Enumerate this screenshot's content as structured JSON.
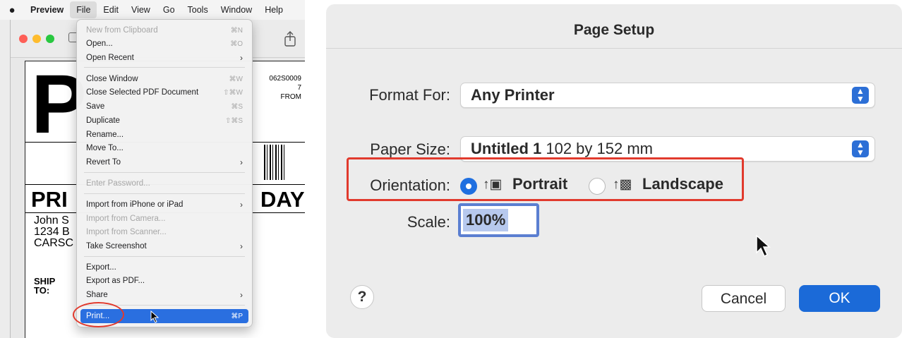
{
  "preview": {
    "menubar": {
      "app_name": "Preview",
      "items": [
        "File",
        "Edit",
        "View",
        "Go",
        "Tools",
        "Window",
        "Help"
      ],
      "active_item": "File"
    },
    "document": {
      "big_letter": "P",
      "tracking_top": "062S0009",
      "tracking_line2": "7",
      "from_label": "FROM",
      "service_left": "PRI",
      "service_right": "DAY",
      "address_lines": [
        "John S",
        "1234 B",
        "CARSC"
      ],
      "ship_to": [
        "SHIP",
        "TO:"
      ]
    },
    "file_menu": [
      {
        "label": "New from Clipboard",
        "shortcut": "⌘N",
        "disabled": true
      },
      {
        "label": "Open...",
        "shortcut": "⌘O"
      },
      {
        "label": "Open Recent",
        "submenu": true
      },
      {
        "label": "Close Window",
        "shortcut": "⌘W"
      },
      {
        "label": "Close Selected PDF Document",
        "shortcut": "⇧⌘W"
      },
      {
        "label": "Save",
        "shortcut": "⌘S"
      },
      {
        "label": "Duplicate",
        "shortcut": "⇧⌘S"
      },
      {
        "label": "Rename..."
      },
      {
        "label": "Move To..."
      },
      {
        "label": "Revert To",
        "submenu": true
      },
      {
        "label": "Enter Password...",
        "disabled": true
      },
      {
        "label": "Import from iPhone or iPad",
        "submenu": true
      },
      {
        "label": "Import from Camera...",
        "disabled": true
      },
      {
        "label": "Import from Scanner...",
        "disabled": true
      },
      {
        "label": "Take Screenshot",
        "submenu": true
      },
      {
        "label": "Export..."
      },
      {
        "label": "Export as PDF..."
      },
      {
        "label": "Share",
        "submenu": true
      },
      {
        "label": "Print...",
        "shortcut": "⌘P",
        "highlighted": true
      }
    ]
  },
  "page_setup": {
    "title": "Page Setup",
    "format_for_label": "Format For:",
    "format_for_value": "Any Printer",
    "paper_size_label": "Paper Size:",
    "paper_size_name": "Untitled 1",
    "paper_size_dims": "102 by 152 mm",
    "orientation_label": "Orientation:",
    "orientation_portrait": "Portrait",
    "orientation_landscape": "Landscape",
    "orientation_selected": "Portrait",
    "scale_label": "Scale:",
    "scale_value": "100%",
    "help_label": "?",
    "cancel_label": "Cancel",
    "ok_label": "OK"
  }
}
